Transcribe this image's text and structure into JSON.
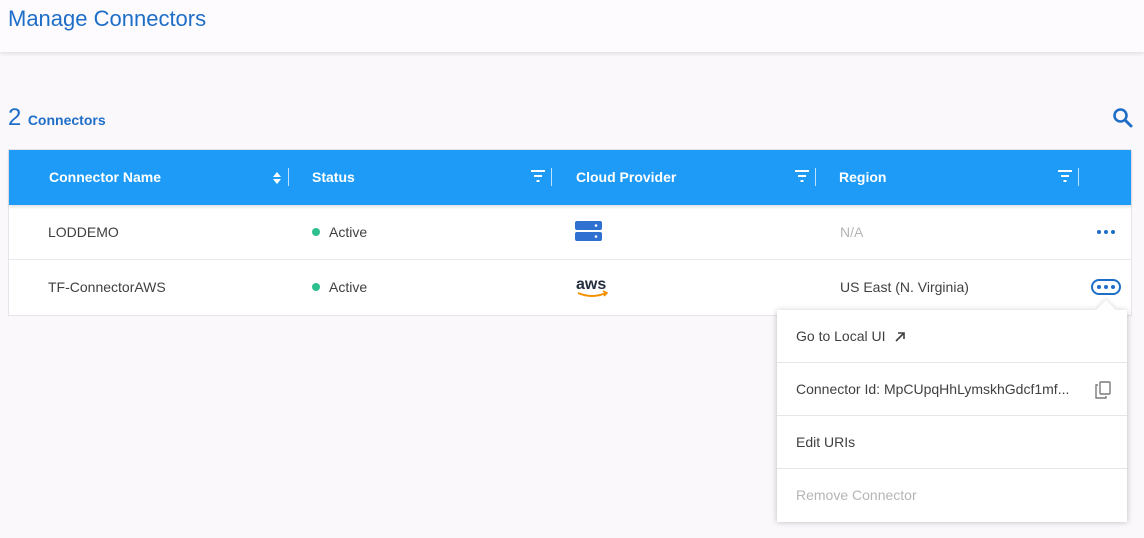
{
  "header": {
    "title": "Manage Connectors"
  },
  "summary": {
    "count": "2",
    "label": "Connectors"
  },
  "table": {
    "columns": [
      "Connector Name",
      "Status",
      "Cloud Provider",
      "Region"
    ],
    "rows": [
      {
        "name": "LODDEMO",
        "status": "Active",
        "provider_icon": "storage-server-icon",
        "region": "N/A"
      },
      {
        "name": "TF-ConnectorAWS",
        "status": "Active",
        "provider_icon": "aws-logo",
        "region": "US East (N. Virginia)"
      }
    ]
  },
  "menu": {
    "go_local": "Go to Local UI",
    "connector_id": "Connector Id: MpCUpqHhLymskhGdcf1mf...",
    "edit_uris": "Edit URIs",
    "remove": "Remove Connector"
  },
  "colors": {
    "accent": "#1e6ec8",
    "header_bg": "#1e9bf7",
    "active": "#2dc08d"
  }
}
